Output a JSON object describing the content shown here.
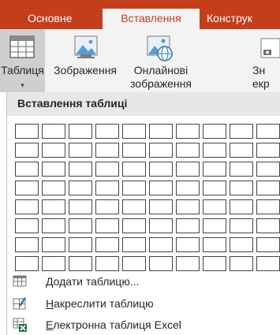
{
  "tabs": {
    "home": "Основне",
    "insert": "Вставлення",
    "design": "Конструк"
  },
  "ribbon": {
    "table": {
      "label": "Таблиця",
      "caret": "▾"
    },
    "pictures": {
      "label": "Зображення"
    },
    "online_pictures": {
      "label_line1": "Онлайнові",
      "label_line2": "зображення"
    },
    "screenshot": {
      "label_line1": "Зн",
      "label_line2": "екр"
    }
  },
  "dropdown": {
    "header": "Вставлення таблиці",
    "grid": {
      "columns": 10,
      "rows": 8
    },
    "items": [
      {
        "accel": "Д",
        "rest": "одати таблицю...",
        "icon": "table-icon"
      },
      {
        "accel": "Н",
        "rest": "акреслити таблицю",
        "icon": "draw-table-icon"
      },
      {
        "accel": "Е",
        "rest": "лектронна таблиця Excel",
        "icon": "excel-table-icon"
      }
    ]
  },
  "colors": {
    "accent": "#c43e1c",
    "ribbon_bg": "#f3f3f3",
    "excel_green": "#217346"
  }
}
